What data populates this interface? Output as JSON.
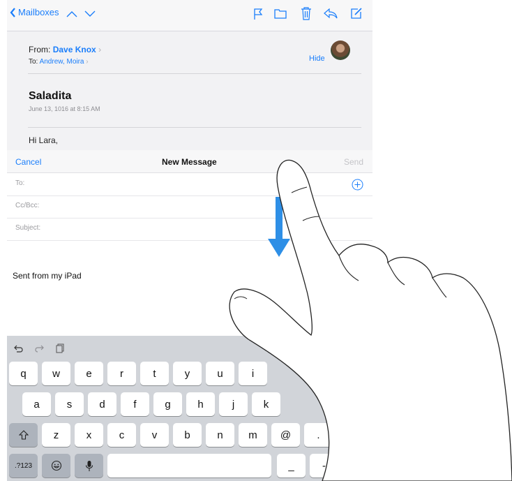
{
  "toolbar": {
    "back_label": "Mailboxes"
  },
  "message": {
    "from_label": "From:",
    "from_name": "Dave Knox",
    "to_label": "To:",
    "to_names": "Andrew, Moira",
    "hide_label": "Hide",
    "subject": "Saladita",
    "date": "June 13, 1016 at 8:15 AM",
    "greeting": "Hi Lara,"
  },
  "compose": {
    "cancel_label": "Cancel",
    "title": "New Message",
    "send_label": "Send",
    "to_label": "To:",
    "ccbcc_label": "Cc/Bcc:",
    "subject_label": "Subject:",
    "body": "Sent from my iPad"
  },
  "keyboard": {
    "row1": [
      "q",
      "w",
      "e",
      "r",
      "t",
      "y",
      "u",
      "i"
    ],
    "row2": [
      "a",
      "s",
      "d",
      "f",
      "g",
      "h",
      "j",
      "k"
    ],
    "row3": [
      "z",
      "x",
      "c",
      "v",
      "b",
      "n",
      "m",
      "@"
    ],
    "numbers_label": ".?123",
    "underscore": "_",
    "dash": "-",
    "period": "."
  },
  "colors": {
    "accent": "#1a7efb",
    "gesture_arrow": "#2e8fe6"
  }
}
